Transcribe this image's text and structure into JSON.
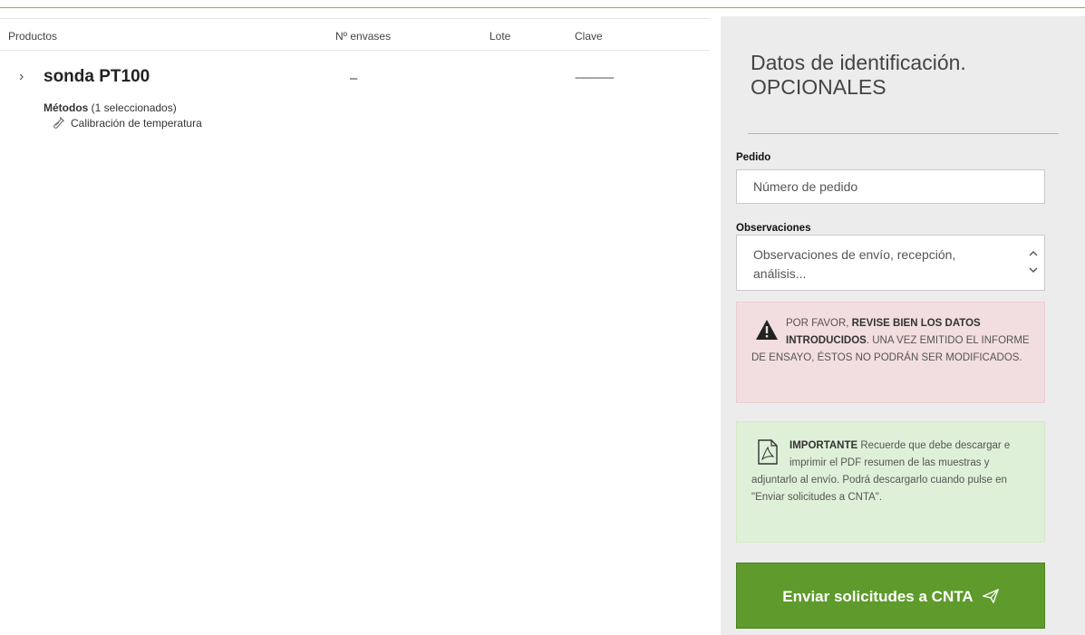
{
  "table": {
    "headers": {
      "productos": "Productos",
      "envases": "Nº envases",
      "lote": "Lote",
      "clave": "Clave"
    },
    "rows": [
      {
        "chevron": "›",
        "name": "sonda PT100",
        "envases": "–",
        "lote": "",
        "clave": "----------------",
        "methods_title": "Métodos",
        "methods_count": " (1 seleccionados)",
        "methods": [
          {
            "label": "Calibración de temperatura",
            "icon": "flask-icon"
          }
        ]
      }
    ]
  },
  "sidebar": {
    "title": "Datos de identificación. OPCIONALES",
    "pedido": {
      "label": "Pedido",
      "placeholder": "Número de pedido"
    },
    "observaciones": {
      "label": "Observaciones",
      "placeholder": "Observaciones de envío, recepción, análisis..."
    },
    "warning": {
      "icon": "warning-icon",
      "prefix": "POR FAVOR, ",
      "strong": "REVISE BIEN LOS DATOS INTRODUCIDOS",
      "rest": ". UNA VEZ EMITIDO EL INFORME DE ENSAYO, ÉSTOS NO PODRÁN SER MODIFICADOS."
    },
    "info": {
      "icon": "pdf-icon",
      "strong": "IMPORTANTE",
      "rest": " Recuerde que debe descargar e imprimir el PDF resumen de las muestras y adjuntarlo al envío. Podrá descargarlo cuando pulse en \"Enviar solicitudes a CNTA\"."
    },
    "send_button": {
      "label": "Enviar solicitudes a CNTA",
      "icon": "paper-plane-icon"
    }
  },
  "colors": {
    "accent_green": "#5e9a2c",
    "top_line": "#8db33a",
    "danger_bg": "#f2dede",
    "success_bg": "#dff0d8",
    "sidebar_bg": "#ececec"
  }
}
